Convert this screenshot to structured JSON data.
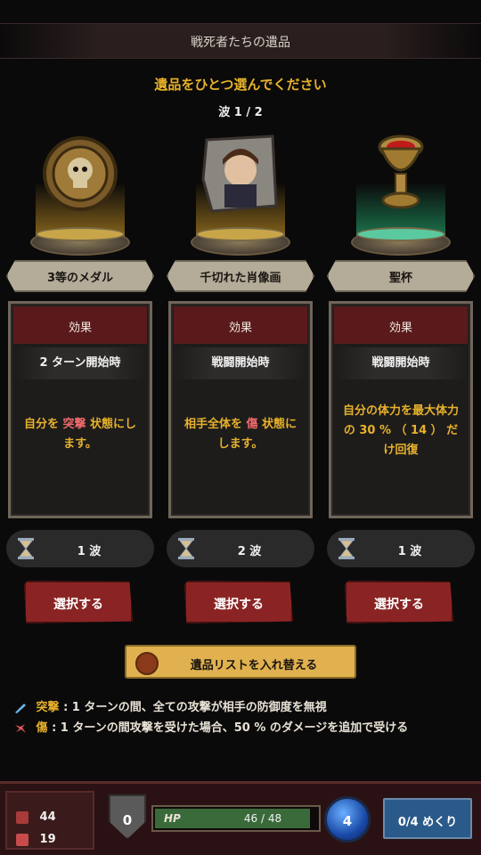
{
  "header": {
    "title": "戦死者たちの遺品"
  },
  "instruction": "遺品をひとつ選んでください",
  "wave": "波 1 / 2",
  "relics": [
    {
      "name": "3等のメダル",
      "icon": "skull-medal-icon",
      "effect_label": "効果",
      "trigger": "2 ターン開始時",
      "desc_pre": "自分を",
      "desc_kw": "突撃",
      "desc_post": "状態にします。",
      "duration": "1 波",
      "select_label": "選択する",
      "glow_color": "#e6aa28"
    },
    {
      "name": "千切れた肖像画",
      "icon": "torn-portrait-icon",
      "effect_label": "効果",
      "trigger": "戦闘開始時",
      "desc_pre": "相手全体を",
      "desc_kw": "傷",
      "desc_post": "状態にします。",
      "duration": "2 波",
      "select_label": "選択する",
      "glow_color": "#e6aa28"
    },
    {
      "name": "聖杯",
      "icon": "holy-grail-icon",
      "effect_label": "効果",
      "trigger": "戦闘開始時",
      "desc_pre": "自分の体力を最大体力の 30 % （ 14 ） だけ回復",
      "desc_kw": "",
      "desc_post": "",
      "duration": "1 波",
      "select_label": "選択する",
      "glow_color": "#28c882"
    }
  ],
  "shuffle_label": "遺品リストを入れ替える",
  "glossary": [
    {
      "term": "突撃",
      "text": " : 1 ターンの間、全ての攻撃が相手の防御度を無視",
      "icon": "charge-icon"
    },
    {
      "term": "傷",
      "text": " : 1 ターンの間攻撃を受けた場合、50 % のダメージを追加で受ける",
      "icon": "wound-icon"
    }
  ],
  "status": {
    "attack": "44",
    "defense": "19",
    "shield": "0",
    "hp_label": "HP",
    "hp_text": "46 / 48",
    "hp_fraction": 0.958,
    "mana": "4",
    "deck_label": "0/4 めくり"
  }
}
